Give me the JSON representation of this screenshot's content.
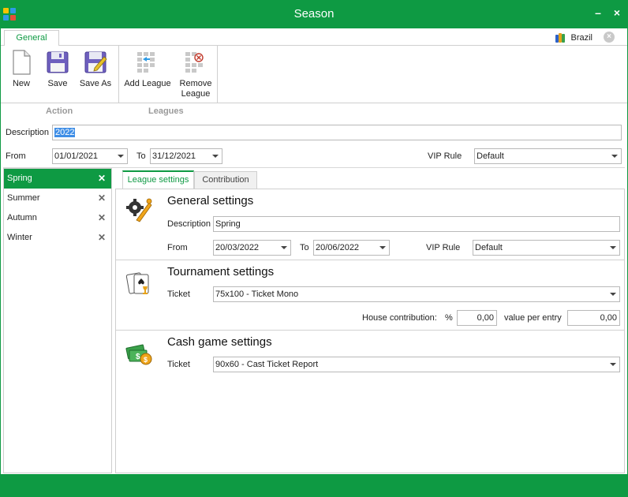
{
  "window": {
    "title": "Season",
    "minimize_label": "–",
    "close_label": "×"
  },
  "ribbon": {
    "tab_general": "General",
    "country": "Brazil",
    "buttons": {
      "new": "New",
      "save": "Save",
      "save_as": "Save As",
      "add_league": "Add League",
      "remove_league_line1": "Remove",
      "remove_league_line2": "League"
    },
    "groups": {
      "action": "Action",
      "leagues": "Leagues"
    }
  },
  "season": {
    "description_label": "Description",
    "description_value": "2022",
    "from_label": "From",
    "from_value": "01/01/2021",
    "to_label": "To",
    "to_value": "31/12/2021",
    "vip_label": "VIP Rule",
    "vip_value": "Default"
  },
  "leagues": [
    {
      "name": "Spring",
      "remove": "✕"
    },
    {
      "name": "Summer",
      "remove": "✕"
    },
    {
      "name": "Autumn",
      "remove": "✕"
    },
    {
      "name": "Winter",
      "remove": "✕"
    }
  ],
  "tabs": {
    "league_settings": "League settings",
    "contribution": "Contribution"
  },
  "general_settings": {
    "title": "General settings",
    "description_label": "Description",
    "description_value": "Spring",
    "from_label": "From",
    "from_value": "20/03/2022",
    "to_label": "To",
    "to_value": "20/06/2022",
    "vip_label": "VIP Rule",
    "vip_value": "Default"
  },
  "tournament_settings": {
    "title": "Tournament settings",
    "ticket_label": "Ticket",
    "ticket_value": "75x100 - Ticket Mono",
    "house_contribution_label": "House contribution:",
    "percent_label": "%",
    "percent_value": "0,00",
    "per_entry_label": "value per entry",
    "per_entry_value": "0,00"
  },
  "cash_game_settings": {
    "title": "Cash game settings",
    "ticket_label": "Ticket",
    "ticket_value": "90x60 - Cast Ticket Report"
  },
  "colors": {
    "accent": "#0e9a43",
    "selection": "#3f8ee6"
  }
}
